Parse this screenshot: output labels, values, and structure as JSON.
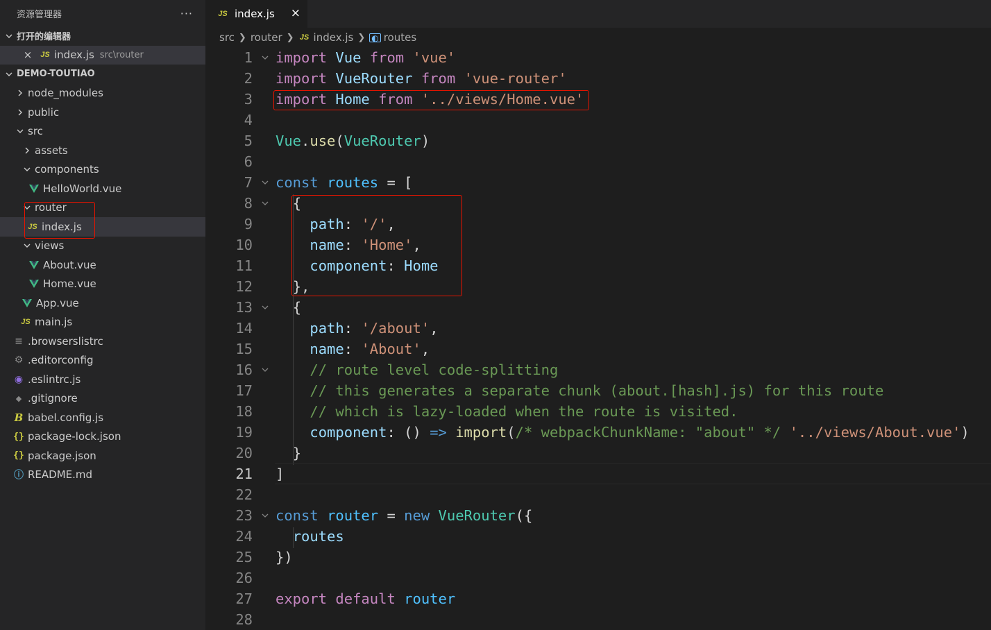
{
  "sidebar": {
    "title": "资源管理器",
    "more": "···",
    "open_editors_label": "打开的编辑器",
    "open_editors": [
      {
        "name": "index.js",
        "path": "src\\router"
      }
    ],
    "project_label": "DEMO-TOUTIAO",
    "tree": [
      {
        "label": "node_modules"
      },
      {
        "label": "public"
      },
      {
        "label": "src"
      },
      {
        "label": "assets"
      },
      {
        "label": "components"
      },
      {
        "label": "HelloWorld.vue"
      },
      {
        "label": "router"
      },
      {
        "label": "index.js"
      },
      {
        "label": "views"
      },
      {
        "label": "About.vue"
      },
      {
        "label": "Home.vue"
      },
      {
        "label": "App.vue"
      },
      {
        "label": "main.js"
      },
      {
        "label": ".browserslistrc"
      },
      {
        "label": ".editorconfig"
      },
      {
        "label": ".eslintrc.js"
      },
      {
        "label": ".gitignore"
      },
      {
        "label": "babel.config.js"
      },
      {
        "label": "package-lock.json"
      },
      {
        "label": "package.json"
      },
      {
        "label": "README.md"
      }
    ]
  },
  "icons": {
    "js": "JS",
    "vue": "vue-icon",
    "brace": "{}",
    "babel": "B",
    "close": "×"
  },
  "editor": {
    "tab_label": "index.js",
    "breadcrumb": [
      "src",
      "router",
      "index.js",
      "routes"
    ],
    "active_line": 21
  },
  "code": {
    "line_numbers": [
      "1",
      "2",
      "3",
      "4",
      "5",
      "6",
      "7",
      "8",
      "9",
      "10",
      "11",
      "12",
      "13",
      "14",
      "15",
      "16",
      "17",
      "18",
      "19",
      "20",
      "21",
      "22",
      "23",
      "24",
      "25",
      "26",
      "27",
      "28"
    ],
    "tokens": [
      [
        "import",
        "Vue",
        "from",
        "'vue'"
      ],
      [
        "import",
        "VueRouter",
        "from",
        "'vue-router'"
      ],
      [
        "import",
        "Home",
        "from",
        "'../views/Home.vue'"
      ],
      [],
      [
        "Vue",
        ".",
        "use",
        "(",
        "VueRouter",
        ")"
      ],
      [],
      [
        "const",
        "routes",
        "=",
        "["
      ],
      [
        "{"
      ],
      [
        "path",
        ":",
        "'/'",
        ","
      ],
      [
        "name",
        ":",
        "'Home'",
        ","
      ],
      [
        "component",
        ":",
        "Home"
      ],
      [
        "},"
      ],
      [
        "{"
      ],
      [
        "path",
        ":",
        "'/about'",
        ","
      ],
      [
        "name",
        ":",
        "'About'",
        ","
      ],
      [
        "// route level code-splitting"
      ],
      [
        "// this generates a separate chunk (about.[hash].js) for this route"
      ],
      [
        "// which is lazy-loaded when the route is visited."
      ],
      [
        "component",
        ":",
        "()",
        "=>",
        "import",
        "(",
        "/* webpackChunkName: \"about\" */",
        "'../views/About.vue'",
        ")"
      ],
      [
        "}"
      ],
      [
        "]"
      ],
      [],
      [
        "const",
        "router",
        "=",
        "new",
        "VueRouter",
        "({"
      ],
      [
        "routes"
      ],
      [
        "})"
      ],
      [],
      [
        "export",
        "default",
        "router"
      ],
      []
    ]
  }
}
